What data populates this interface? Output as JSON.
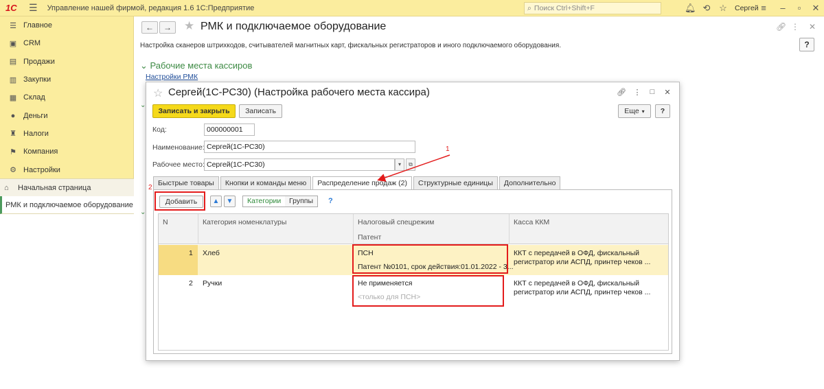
{
  "app": {
    "logo": "1С",
    "title": "Управление нашей фирмой, редакция 1.6 1С:Предприятие",
    "search_placeholder": "Поиск Ctrl+Shift+F",
    "user": "Сергей"
  },
  "sidebar": {
    "items": [
      {
        "label": "Главное",
        "icon": "menu-icon"
      },
      {
        "label": "CRM",
        "icon": "crm-icon"
      },
      {
        "label": "Продажи",
        "icon": "sales-icon"
      },
      {
        "label": "Закупки",
        "icon": "purchases-icon"
      },
      {
        "label": "Склад",
        "icon": "warehouse-icon"
      },
      {
        "label": "Деньги",
        "icon": "money-icon"
      },
      {
        "label": "Налоги",
        "icon": "taxes-icon"
      },
      {
        "label": "Компания",
        "icon": "flag-icon"
      },
      {
        "label": "Настройки",
        "icon": "gear-icon"
      }
    ],
    "home": "Начальная страница",
    "open_page": "РМК и подключаемое оборудование"
  },
  "page": {
    "title": "РМК и подключаемое оборудование",
    "description": "Настройка сканеров штрихкодов, считывателей магнитных карт, фискальных регистраторов и иного подключаемого оборудования.",
    "help": "?",
    "section_title": "Рабочие места кассиров",
    "section_link": "Настройки РМК"
  },
  "modal": {
    "title": "Сергей(1С-РС30) (Настройка рабочего места кассира)",
    "save_close": "Записать и закрыть",
    "save": "Записать",
    "more": "Еще",
    "help": "?",
    "code_label": "Код:",
    "code_value": "000000001",
    "name_label": "Наименование:",
    "name_value": "Сергей(1С-РС30)",
    "workplace_label": "Рабочее место:",
    "workplace_value": "Сергей(1С-РС30)",
    "tabs": [
      "Быстрые товары",
      "Кнопки и команды меню",
      "Распределение продаж (2)",
      "Структурные единицы",
      "Дополнительно"
    ],
    "add": "Добавить",
    "seg_categories": "Категории",
    "seg_groups": "Группы",
    "q": "?",
    "columns": {
      "n": "N",
      "category": "Категория номенклатуры",
      "tax": "Налоговый спецрежим",
      "patent": "Патент",
      "kkm": "Касса ККМ"
    },
    "rows": [
      {
        "n": "1",
        "category": "Хлеб",
        "tax": "ПСН",
        "patent": "Патент №0101, срок действия:01.01.2022 - 3...",
        "kkm1": "ККТ с передачей в ОФД, фискальный",
        "kkm2": "регистратор или АСПД, принтер чеков ..."
      },
      {
        "n": "2",
        "category": "Ручки",
        "tax": "Не применяется",
        "patent": "<только для ПСН>",
        "kkm1": "ККТ с передачей в ОФД, фискальный",
        "kkm2": "регистратор или АСПД, принтер чеков ..."
      }
    ]
  },
  "annotations": {
    "one": "1",
    "two": "2"
  },
  "colors": {
    "accent_yellow": "#fbed9e",
    "primary_button": "#f5d91a",
    "section_green": "#3d8a44",
    "annotation_red": "#e31b1b"
  }
}
